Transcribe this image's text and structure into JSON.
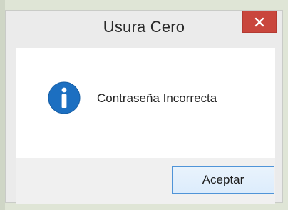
{
  "dialog": {
    "title": "Usura Cero",
    "close_glyph": "×",
    "message": "Contraseña Incorrecta",
    "icon": "info-icon",
    "ok_label": "Aceptar"
  },
  "colors": {
    "close_bg": "#c9463d",
    "info_icon": "#1c6fc1",
    "button_border": "#4f94d8",
    "frame_bg": "#ebebeb"
  }
}
